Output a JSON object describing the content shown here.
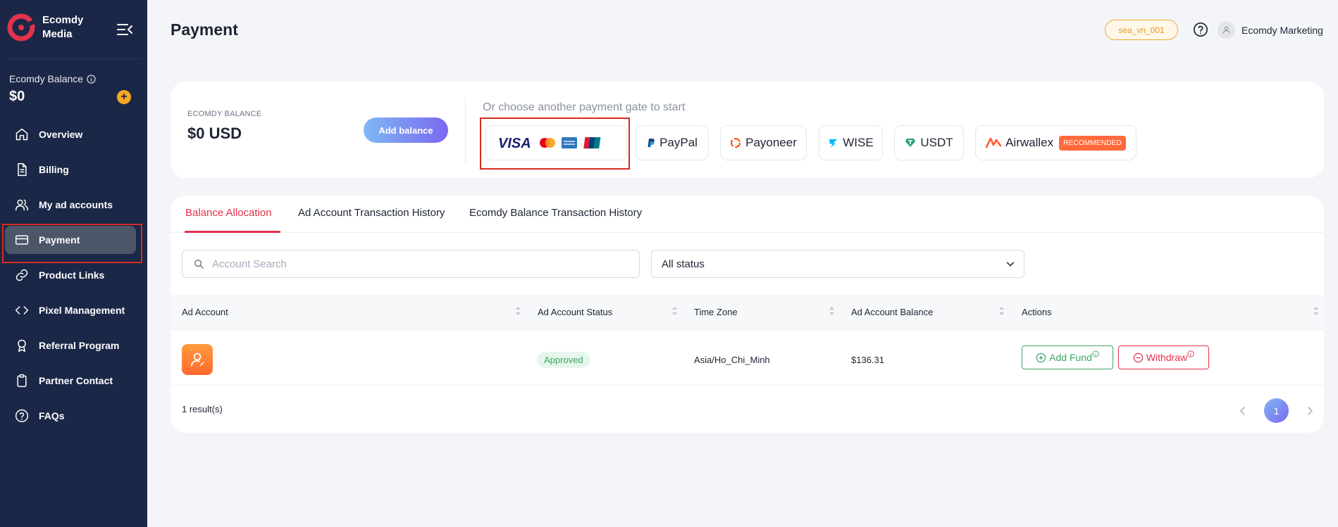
{
  "brand": {
    "name_line1": "Ecomdy",
    "name_line2": "Media",
    "color": "#e2334b"
  },
  "sidebar": {
    "balance_label": "Ecomdy Balance",
    "balance_value": "$0",
    "items": [
      {
        "label": "Overview",
        "icon": "home-icon"
      },
      {
        "label": "Billing",
        "icon": "document-icon"
      },
      {
        "label": "My ad accounts",
        "icon": "users-icon"
      },
      {
        "label": "Payment",
        "icon": "credit-card-icon",
        "active": true
      },
      {
        "label": "Product Links",
        "icon": "link-icon"
      },
      {
        "label": "Pixel Management",
        "icon": "code-icon"
      },
      {
        "label": "Referral Program",
        "icon": "award-icon"
      },
      {
        "label": "Partner Contact",
        "icon": "clipboard-icon"
      },
      {
        "label": "FAQs",
        "icon": "help-circle-icon"
      }
    ]
  },
  "header": {
    "title": "Payment",
    "account_badge": "sea_vn_001",
    "user_name": "Ecomdy Marketing"
  },
  "balance_card": {
    "label": "ECOMDY BALANCE",
    "value": "$0 USD",
    "add_button": "Add balance",
    "gate_title": "Or choose another payment gate to start",
    "gates": [
      {
        "name": "cards",
        "brands": [
          "VISA",
          "Mastercard",
          "Amex",
          "UnionPay"
        ]
      },
      {
        "label": "PayPal"
      },
      {
        "label": "Payoneer"
      },
      {
        "label": "WISE"
      },
      {
        "label": "USDT"
      },
      {
        "label": "Airwallex",
        "badge": "RECOMMENDED"
      }
    ]
  },
  "tabs": [
    "Balance Allocation",
    "Ad Account Transaction History",
    "Ecomdy Balance Transaction History"
  ],
  "filters": {
    "search_placeholder": "Account Search",
    "status_value": "All status"
  },
  "table": {
    "columns": [
      "Ad Account",
      "Ad Account Status",
      "Time Zone",
      "Ad Account Balance",
      "Actions"
    ],
    "rows": [
      {
        "status": "Approved",
        "timezone": "Asia/Ho_Chi_Minh",
        "balance": "$136.31",
        "add_fund": "Add Fund",
        "withdraw": "Withdraw"
      }
    ],
    "results": "1 result(s)",
    "current_page": "1"
  },
  "colors": {
    "sidebar": "#1b2746",
    "accent_red": "#e2334b",
    "success": "#3aa663",
    "badge_orange": "#f0a830"
  }
}
